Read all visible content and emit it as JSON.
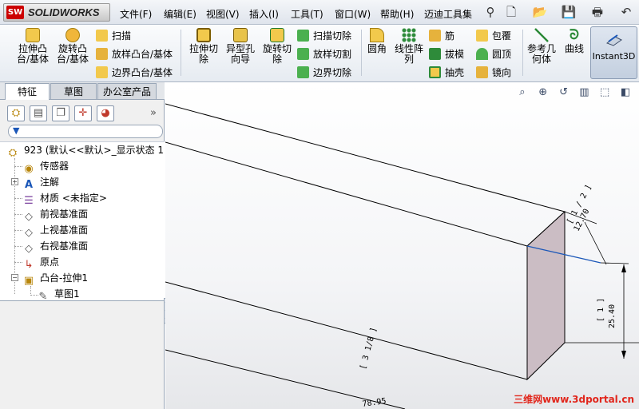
{
  "app": {
    "logo_text": "SOLIDWORKS",
    "logo_badge": "SW"
  },
  "menu": [
    "文件(F)",
    "编辑(E)",
    "视图(V)",
    "插入(I)",
    "工具(T)",
    "窗口(W)",
    "帮助(H)",
    "迈迪工具集"
  ],
  "command_manager": {
    "big_buttons": [
      {
        "label_l1": "拉伸凸",
        "label_l2": "台/基体",
        "icon": "extrude-boss-icon"
      },
      {
        "label_l1": "旋转凸",
        "label_l2": "台/基体",
        "icon": "revolve-boss-icon"
      },
      {
        "label_l1": "拉伸切",
        "label_l2": "除",
        "icon": "extrude-cut-icon"
      },
      {
        "label_l1": "异型孔",
        "label_l2": "向导",
        "icon": "hole-wizard-icon"
      },
      {
        "label_l1": "旋转切",
        "label_l2": "除",
        "icon": "revolve-cut-icon"
      },
      {
        "label_l1": "圆角",
        "label_l2": "",
        "icon": "fillet-icon"
      },
      {
        "label_l1": "线性阵",
        "label_l2": "列",
        "icon": "linear-pattern-icon"
      },
      {
        "label_l1": "参考几",
        "label_l2": "何体",
        "icon": "reference-geometry-icon"
      },
      {
        "label_l1": "曲线",
        "label_l2": "",
        "icon": "curves-icon"
      }
    ],
    "small_buttons": {
      "sweep": "扫描",
      "loft": "放样凸台/基体",
      "boundary_boss": "边界凸台/基体",
      "sweep_cut": "扫描切除",
      "loft_cut": "放样切割",
      "boundary_cut": "边界切除",
      "rib": "筋",
      "draft": "拔模",
      "shell": "抽壳",
      "wrap": "包覆",
      "dome": "圆顶",
      "mirror": "镜向"
    },
    "instant3d": "Instant3D"
  },
  "panel": {
    "tabs": [
      "特征",
      "草图",
      "办公室产品"
    ],
    "tree": {
      "root": "923  (默认<<默认>_显示状态 1",
      "items": [
        "传感器",
        "注解",
        "材质 <未指定>",
        "前视基准面",
        "上视基准面",
        "右视基准面",
        "原点",
        "凸台-拉伸1"
      ],
      "child": "草图1"
    }
  },
  "graphics": {
    "dim_width_frac": "[ 1 / 2 ]",
    "dim_width_value": "12.70",
    "dim_height_frac": "[ 1 ]",
    "dim_height_value": "25.40",
    "dim_length_frac": "[ 3 1/8 ]",
    "dim_length_value": "78.95"
  },
  "watermark": "三维网www.3dportal.cn",
  "colors": {
    "accent": "#1b57b8",
    "face_shade": "#cbbdc4",
    "watermark": "#e1261c"
  }
}
